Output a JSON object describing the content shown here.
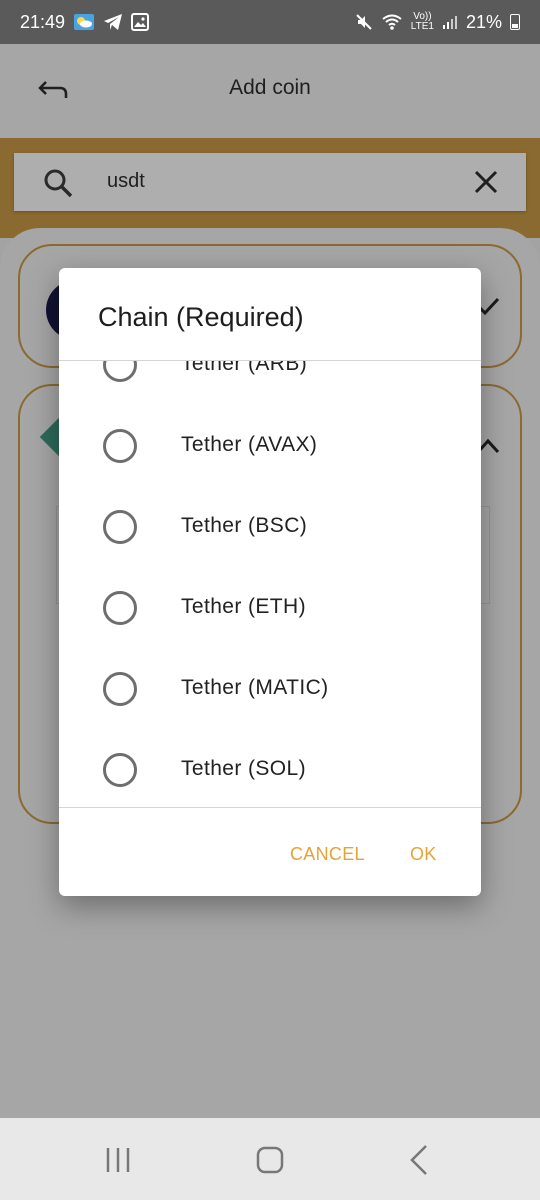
{
  "status_bar": {
    "time": "21:49",
    "battery": "21%",
    "icons_left": [
      "weather-icon",
      "telegram-icon",
      "gallery-icon"
    ],
    "icons_right": [
      "mute-icon",
      "wifi-icon",
      "volte-icon",
      "signal-icon",
      "battery-icon"
    ],
    "volte_text_top": "Vo))",
    "volte_text_bottom": "LTE1"
  },
  "app_bar": {
    "title": "Add coin"
  },
  "search": {
    "value": "usdt"
  },
  "dialog": {
    "title": "Chain (Required)",
    "options": [
      {
        "label": "Tether (ARB)",
        "selected": false
      },
      {
        "label": "Tether (AVAX)",
        "selected": false
      },
      {
        "label": "Tether (BSC)",
        "selected": false
      },
      {
        "label": "Tether (ETH)",
        "selected": false
      },
      {
        "label": "Tether (MATIC)",
        "selected": false
      },
      {
        "label": "Tether (SOL)",
        "selected": false
      }
    ],
    "cancel_label": "CANCEL",
    "ok_label": "OK"
  },
  "colors": {
    "accent": "#e6a335",
    "scrim_gray": "#a6a6a6",
    "status_bar": "#5a5a5a"
  }
}
